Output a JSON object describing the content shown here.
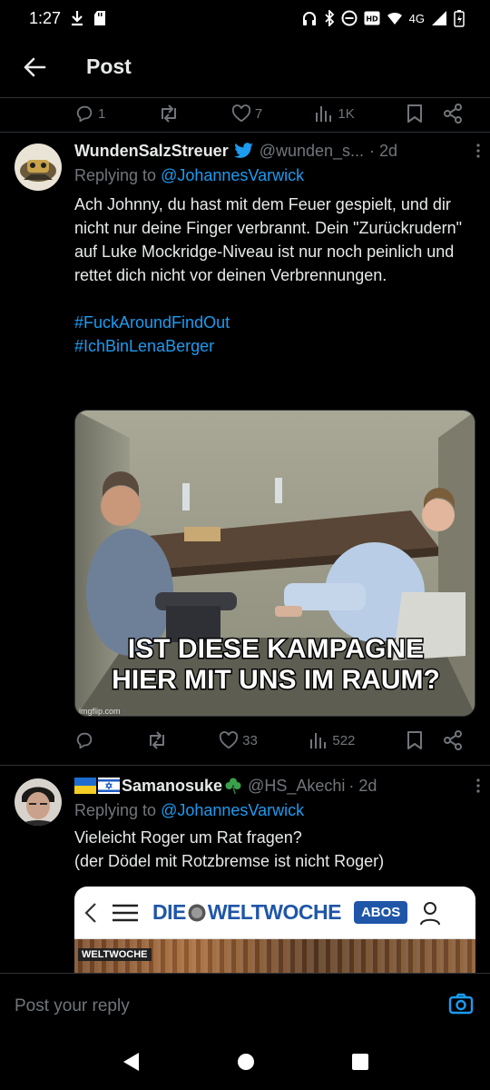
{
  "status": {
    "time": "1:27",
    "network": "4G"
  },
  "header": {
    "title": "Post"
  },
  "top_actions": {
    "replies": "1",
    "likes": "7",
    "views": "1K"
  },
  "tweet1": {
    "name": "WundenSalzStreuer",
    "handle": "@wunden_s...",
    "time": "· 2d",
    "replying_prefix": "Replying to",
    "replying_to": "@JohannesVarwick",
    "text": "Ach Johnny, du hast mit dem Feuer gespielt, und dir nicht nur deine Finger verbrannt. Dein \"Zurückrudern\" auf Luke Mockridge-Niveau ist nur noch peinlich und rettet dich nicht vor deinen Verbrennungen.",
    "hashtags": [
      "#FuckAroundFindOut",
      "#IchBinLenaBerger"
    ],
    "meme": {
      "line1": "IST DIESE KAMPAGNE",
      "line2": "HIER MIT UNS IM RAUM?",
      "watermark": "imgflip.com"
    },
    "likes": "33",
    "views": "522"
  },
  "tweet2": {
    "name": "Samanosuke",
    "handle": "@HS_Akechi",
    "time": "· 2d",
    "replying_prefix": "Replying to",
    "replying_to": "@JohannesVarwick",
    "text_line1": "Vieleicht Roger um Rat fragen?",
    "text_line2": "(der Dödel mit Rotzbremse ist nicht Roger)",
    "embed": {
      "logo_left": "DIE",
      "logo_right": "WELTWOCHE",
      "abos": "ABOS",
      "banner": "WELTWOCHE"
    }
  },
  "composer": {
    "placeholder": "Post your reply"
  },
  "colors": {
    "accent": "#1d9bf0",
    "muted": "#71767b",
    "text": "#e7e9ea",
    "bg": "#000000"
  }
}
